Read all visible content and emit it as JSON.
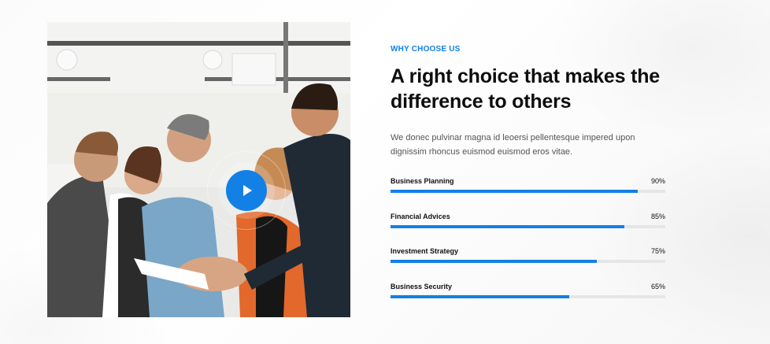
{
  "section": {
    "eyebrow": "WHY CHOOSE US",
    "heading": "A right choice that makes the difference to others",
    "description": "We donec pulvinar magna id leoersi pellentesque impered upon dignissim rhoncus euismod euismod eros vitae."
  },
  "video": {
    "play_icon": "play-icon",
    "accent_color": "#1380e6"
  },
  "skills": [
    {
      "label": "Business Planning",
      "percent_text": "90%",
      "value": 0.9
    },
    {
      "label": "Financial Advices",
      "percent_text": "85%",
      "value": 0.85
    },
    {
      "label": "Investment Strategy",
      "percent_text": "75%",
      "value": 0.75
    },
    {
      "label": "Business Security",
      "percent_text": "65%",
      "value": 0.65
    }
  ]
}
